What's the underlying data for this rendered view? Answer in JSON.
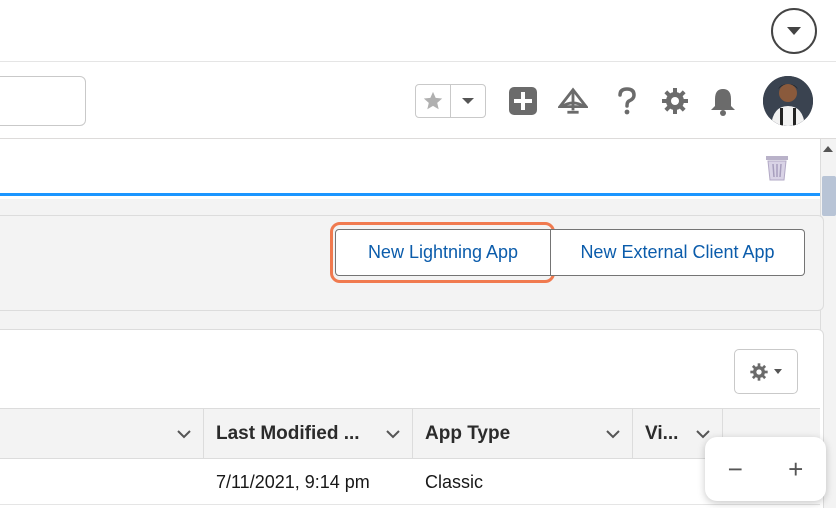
{
  "actions": {
    "new_lightning_app": "New Lightning App",
    "new_external_client_app": "New External Client App"
  },
  "table": {
    "columns": [
      "",
      "Last Modified ...",
      "App Type",
      "Vi..."
    ],
    "rows": [
      {
        "last_modified": "7/11/2021, 9:14 pm",
        "app_type": "Classic"
      }
    ]
  },
  "zoom": {
    "out": "−",
    "in": "+"
  },
  "colors": {
    "accent": "#1b96ff",
    "link": "#0b5cab",
    "highlight": "#f07a4f"
  },
  "icons": {
    "top": "chevron-down-icon",
    "favorites": "star-icon",
    "global_actions": "plus-square-icon",
    "trailhead": "trailhead-icon",
    "help": "help-icon",
    "setup": "gear-icon",
    "notifications": "bell-icon",
    "recycle": "trash-icon"
  }
}
